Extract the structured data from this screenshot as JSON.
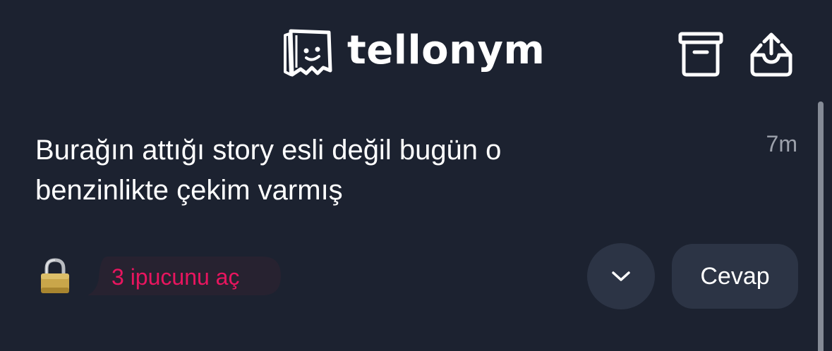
{
  "header": {
    "brand": "tellonym",
    "logo_icon": "tellonym-ghost-logo",
    "actions": [
      {
        "icon": "archive-box-icon"
      },
      {
        "icon": "share-tray-icon"
      }
    ]
  },
  "tell": {
    "message": "Burağın attığı story esli değil bugün o benzinlikte çekim varmış",
    "time": "7m"
  },
  "footer": {
    "lock_icon": "lock-emoji-icon",
    "hint_label": "3 ipucunu aç",
    "expand_icon": "chevron-down-icon",
    "reply_label": "Cevap"
  },
  "colors": {
    "background": "#1c2230",
    "button_bg": "#2c3445",
    "hint_bg": "#272230",
    "hint_text": "#e8155f",
    "muted_text": "#9ca1ab"
  }
}
